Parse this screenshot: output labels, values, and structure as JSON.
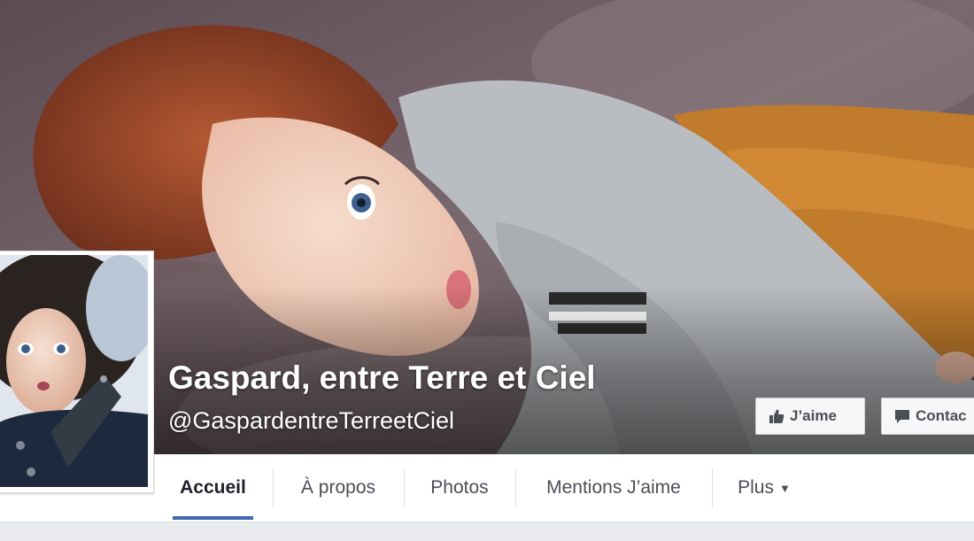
{
  "page": {
    "title": "Gaspard, entre Terre et Ciel",
    "handle": "@GaspardentreTerreetCiel"
  },
  "actions": {
    "like_label": "J’aime",
    "contact_label": "Contac"
  },
  "tabs": [
    {
      "label": "Accueil",
      "active": true
    },
    {
      "label": "À propos",
      "active": false
    },
    {
      "label": "Photos",
      "active": false
    },
    {
      "label": "Mentions J’aime",
      "active": false
    },
    {
      "label": "Plus",
      "active": false
    }
  ],
  "icons": {
    "like": "thumbs-up-icon",
    "contact": "message-icon",
    "more": "caret-down-icon"
  },
  "colors": {
    "tab_active_underline": "#4267b2",
    "button_bg": "#f6f7f9",
    "tab_bar_bg": "#ffffff",
    "page_bg": "#e9ebee"
  }
}
